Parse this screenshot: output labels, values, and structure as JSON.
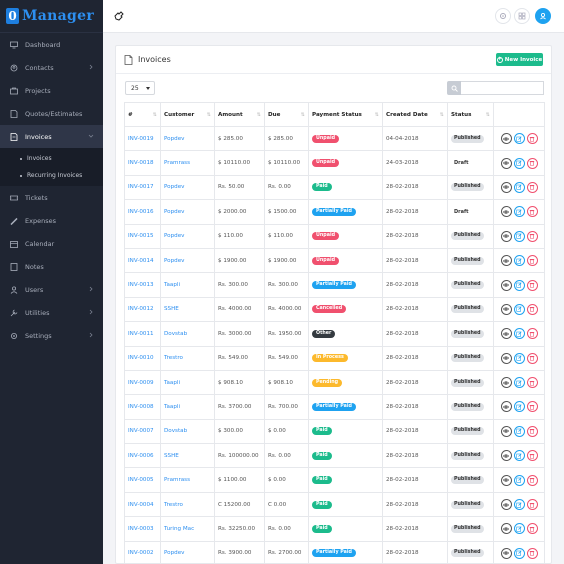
{
  "app": {
    "logo_letter": "0",
    "logo_text": "Manager"
  },
  "sidebar": {
    "items": [
      {
        "label": "Dashboard",
        "icon": "monitor-icon",
        "chevron": false
      },
      {
        "label": "Contacts",
        "icon": "contacts-icon",
        "chevron": true
      },
      {
        "label": "Projects",
        "icon": "projects-icon",
        "chevron": false
      },
      {
        "label": "Quotes/Estimates",
        "icon": "quotes-icon",
        "chevron": false
      },
      {
        "label": "Invoices",
        "icon": "invoices-icon",
        "chevron": true,
        "active": true
      },
      {
        "label": "Tickets",
        "icon": "ticket-icon",
        "chevron": false
      },
      {
        "label": "Expenses",
        "icon": "expenses-icon",
        "chevron": false
      },
      {
        "label": "Calendar",
        "icon": "calendar-icon",
        "chevron": false
      },
      {
        "label": "Notes",
        "icon": "notes-icon",
        "chevron": false
      },
      {
        "label": "Users",
        "icon": "users-icon",
        "chevron": true
      },
      {
        "label": "Utilities",
        "icon": "utilities-icon",
        "chevron": true
      },
      {
        "label": "Settings",
        "icon": "settings-icon",
        "chevron": true
      }
    ],
    "submenu": [
      "Invoices",
      "Recurring Invoices"
    ]
  },
  "card": {
    "title": "Invoices",
    "new_button": "New Invoice"
  },
  "controls": {
    "page_size": "25"
  },
  "table": {
    "headers": [
      "#",
      "Customer",
      "Amount",
      "Due",
      "Payment Status",
      "Created Date",
      "Status",
      ""
    ],
    "rows": [
      {
        "id": "INV-0019",
        "customer": "Popdev",
        "amount": "$ 285.00",
        "due": "$ 285.00",
        "payment": "Unpaid",
        "date": "04-04-2018",
        "status": "Published"
      },
      {
        "id": "INV-0018",
        "customer": "Pramrass",
        "amount": "$ 10110.00",
        "due": "$ 10110.00",
        "payment": "Unpaid",
        "date": "24-03-2018",
        "status": "Draft"
      },
      {
        "id": "INV-0017",
        "customer": "Popdev",
        "amount": "Rs. 50.00",
        "due": "Rs. 0.00",
        "payment": "Paid",
        "date": "28-02-2018",
        "status": "Published"
      },
      {
        "id": "INV-0016",
        "customer": "Popdev",
        "amount": "$ 2000.00",
        "due": "$ 1500.00",
        "payment": "Partially Paid",
        "date": "28-02-2018",
        "status": "Draft"
      },
      {
        "id": "INV-0015",
        "customer": "Popdev",
        "amount": "$ 110.00",
        "due": "$ 110.00",
        "payment": "Unpaid",
        "date": "28-02-2018",
        "status": "Published"
      },
      {
        "id": "INV-0014",
        "customer": "Popdev",
        "amount": "$ 1900.00",
        "due": "$ 1900.00",
        "payment": "Unpaid",
        "date": "28-02-2018",
        "status": "Published"
      },
      {
        "id": "INV-0013",
        "customer": "Taapli",
        "amount": "Rs. 300.00",
        "due": "Rs. 300.00",
        "payment": "Partially Paid",
        "date": "28-02-2018",
        "status": "Published"
      },
      {
        "id": "INV-0012",
        "customer": "SSHE",
        "amount": "Rs. 4000.00",
        "due": "Rs. 4000.00",
        "payment": "Cancelled",
        "date": "28-02-2018",
        "status": "Published"
      },
      {
        "id": "INV-0011",
        "customer": "Dovstab",
        "amount": "Rs. 3000.00",
        "due": "Rs. 1950.00",
        "payment": "Other",
        "date": "28-02-2018",
        "status": "Published"
      },
      {
        "id": "INV-0010",
        "customer": "Trestro",
        "amount": "Rs. 549.00",
        "due": "Rs. 549.00",
        "payment": "In Process",
        "date": "28-02-2018",
        "status": "Published"
      },
      {
        "id": "INV-0009",
        "customer": "Taapli",
        "amount": "$ 908.10",
        "due": "$ 908.10",
        "payment": "Pending",
        "date": "28-02-2018",
        "status": "Published"
      },
      {
        "id": "INV-0008",
        "customer": "Taapli",
        "amount": "Rs. 3700.00",
        "due": "Rs. 700.00",
        "payment": "Partially Paid",
        "date": "28-02-2018",
        "status": "Published"
      },
      {
        "id": "INV-0007",
        "customer": "Dovstab",
        "amount": "$ 300.00",
        "due": "$ 0.00",
        "payment": "Paid",
        "date": "28-02-2018",
        "status": "Published"
      },
      {
        "id": "INV-0006",
        "customer": "SSHE",
        "amount": "Rs. 100000.00",
        "due": "Rs. 0.00",
        "payment": "Paid",
        "date": "28-02-2018",
        "status": "Published"
      },
      {
        "id": "INV-0005",
        "customer": "Pramrass",
        "amount": "$ 1100.00",
        "due": "$ 0.00",
        "payment": "Paid",
        "date": "28-02-2018",
        "status": "Published"
      },
      {
        "id": "INV-0004",
        "customer": "Trestro",
        "amount": "C 15200.00",
        "due": "C 0.00",
        "payment": "Paid",
        "date": "28-02-2018",
        "status": "Published"
      },
      {
        "id": "INV-0003",
        "customer": "Turing Mac",
        "amount": "Rs. 32250.00",
        "due": "Rs. 0.00",
        "payment": "Paid",
        "date": "28-02-2018",
        "status": "Published"
      },
      {
        "id": "INV-0002",
        "customer": "Popdev",
        "amount": "Rs. 3900.00",
        "due": "Rs. 2700.00",
        "payment": "Partially Paid",
        "date": "28-02-2018",
        "status": "Published"
      }
    ]
  },
  "colors": {
    "Unpaid": "#f0506e",
    "Paid": "#1cbb8c",
    "Partially Paid": "#1ea2f0",
    "Cancelled": "#f0506e",
    "Other": "#343a40",
    "In Process": "#fcb92c",
    "Pending": "#fcb92c"
  }
}
